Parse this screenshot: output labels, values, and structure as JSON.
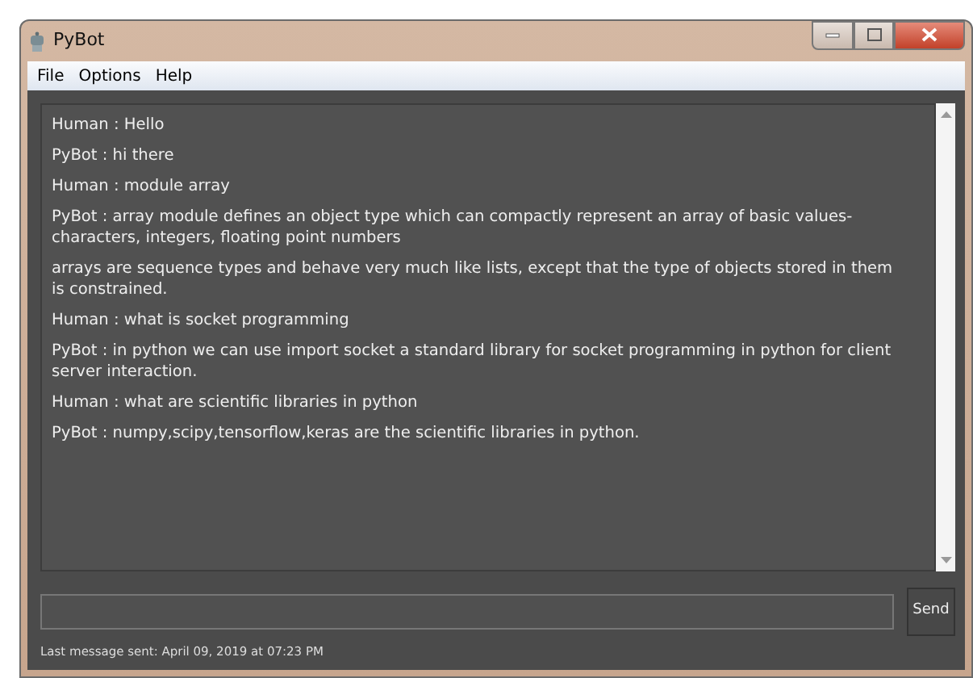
{
  "window": {
    "title": "PyBot"
  },
  "menu": [
    "File",
    "Options",
    "Help"
  ],
  "messages": [
    {
      "text": "Human : Hello"
    },
    {
      "text": "PyBot : hi there"
    },
    {
      "text": "Human : module array"
    },
    {
      "text": "PyBot : array module defines an object type which can compactly represent an array of basic values- characters, integers, floating point numbers"
    },
    {
      "text": "arrays are sequence types and behave very much like lists, except that the type of objects stored in them is constrained."
    },
    {
      "text": "Human : what is socket programming"
    },
    {
      "text": "PyBot : in python we can use import socket a standard library for socket programming in python for client server interaction."
    },
    {
      "text": "Human : what are scientific libraries in python"
    },
    {
      "text": "PyBot : numpy,scipy,tensorflow,keras are the scientific libraries in python."
    }
  ],
  "send_button": "Send",
  "status": "Last message sent: April 09, 2019 at 07:23 PM"
}
